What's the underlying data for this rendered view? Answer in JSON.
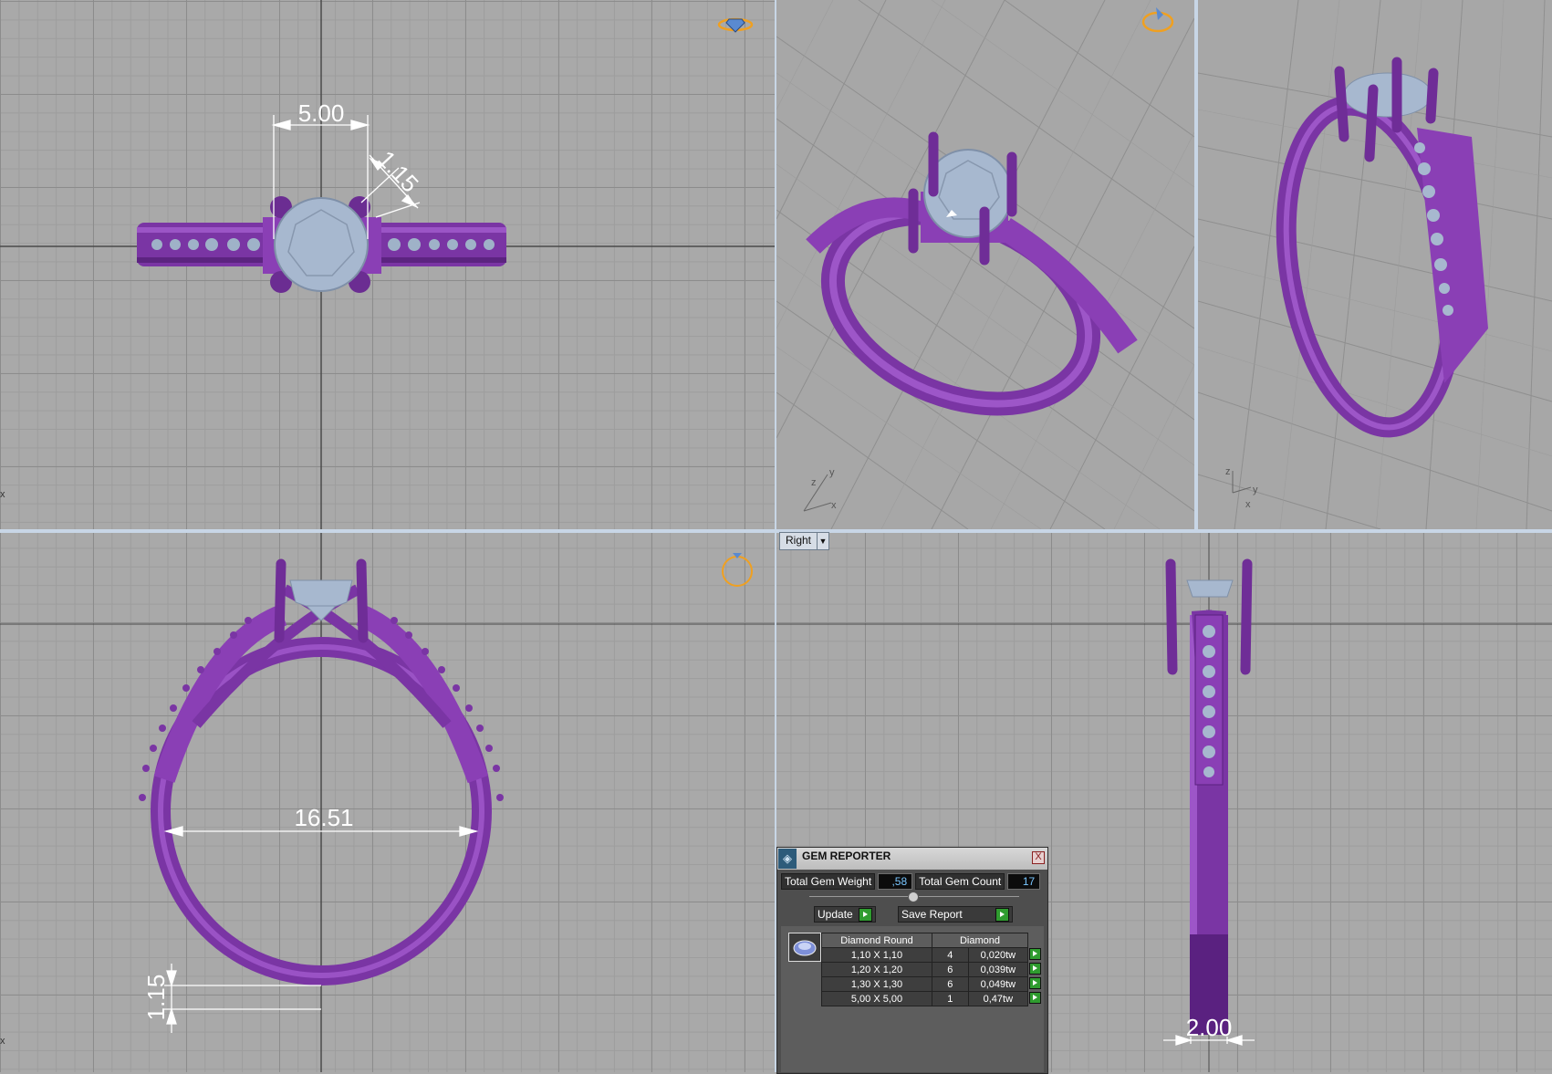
{
  "viewports": {
    "top_left": {
      "dimensions": {
        "width_label": "5.00",
        "prong_label": "1.15"
      }
    },
    "bottom_left": {
      "dimensions": {
        "inner_diameter_label": "16.51",
        "band_thickness_label": "1.15"
      }
    },
    "bottom_right": {
      "view_selector": {
        "label": "Right"
      },
      "dimensions": {
        "band_width_label": "2.00"
      }
    },
    "axis_labels": {
      "x": "x",
      "y": "y",
      "z": "z"
    }
  },
  "colors": {
    "metal": "#8a3fb5",
    "metal_dark": "#5d2680",
    "gem": "#a7b8cf",
    "dimension_lines": "#ffffff",
    "orientation_gizmo": "#f0a020"
  },
  "gem_reporter": {
    "title": "GEM REPORTER",
    "close_label": "X",
    "total_weight_label": "Total Gem Weight",
    "total_weight_value": ",58",
    "total_count_label": "Total Gem Count",
    "total_count_value": "17",
    "update_label": "Update",
    "save_report_label": "Save Report",
    "table": {
      "headers": [
        "Diamond Round",
        "Diamond"
      ],
      "rows": [
        {
          "size": "1,10 X 1,10",
          "count": "4",
          "weight": "0,020tw"
        },
        {
          "size": "1,20 X 1,20",
          "count": "6",
          "weight": "0,039tw"
        },
        {
          "size": "1,30 X 1,30",
          "count": "6",
          "weight": "0,049tw"
        },
        {
          "size": "5,00 X 5,00",
          "count": "1",
          "weight": "0,47tw"
        }
      ]
    }
  }
}
